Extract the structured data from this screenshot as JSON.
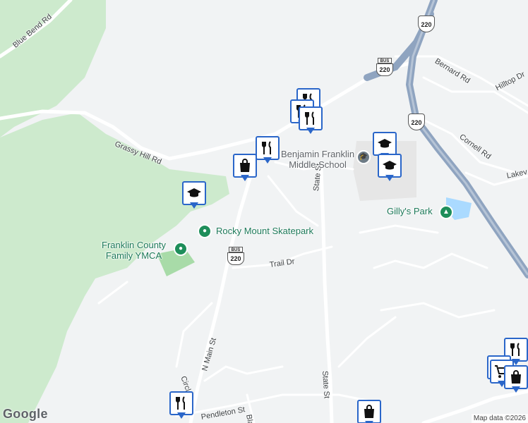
{
  "map": {
    "attribution": "Map data ©2026",
    "logo": "Google"
  },
  "roads": [
    {
      "name": "Blue Bend Rd"
    },
    {
      "name": "Grassy Hill Rd"
    },
    {
      "name": "Bernard Rd"
    },
    {
      "name": "Hilltop Dr"
    },
    {
      "name": "Cornell Rd"
    },
    {
      "name": "Lakev"
    },
    {
      "name": "State St"
    },
    {
      "name": "State St"
    },
    {
      "name": "Trail Dr"
    },
    {
      "name": "N Main St"
    },
    {
      "name": "Circle"
    },
    {
      "name": "Pendleton St"
    },
    {
      "name": "Bland"
    }
  ],
  "places": [
    {
      "name": "Benjamin Franklin\nMiddle School",
      "icon": "school-icon"
    },
    {
      "name": "Gilly's Park",
      "icon": "park-icon"
    },
    {
      "name": "Rocky Mount Skatepark",
      "icon": "park-icon"
    },
    {
      "name": "Franklin County\nFamily YMCA",
      "icon": "park-icon"
    }
  ],
  "route_shields": [
    {
      "top": "",
      "number": "220"
    },
    {
      "top": "BUS",
      "number": "220"
    },
    {
      "top": "",
      "number": "220"
    },
    {
      "top": "BUS",
      "number": "220"
    }
  ],
  "markers": [
    {
      "type": "restaurant",
      "icon": "fork-knife-icon"
    },
    {
      "type": "restaurant",
      "icon": "fork-knife-icon"
    },
    {
      "type": "restaurant",
      "icon": "fork-knife-icon"
    },
    {
      "type": "restaurant",
      "icon": "fork-knife-icon"
    },
    {
      "type": "shopping",
      "icon": "shopping-bag-icon"
    },
    {
      "type": "school",
      "icon": "graduation-cap-icon"
    },
    {
      "type": "school",
      "icon": "graduation-cap-icon"
    },
    {
      "type": "school",
      "icon": "graduation-cap-icon"
    },
    {
      "type": "restaurant",
      "icon": "fork-knife-icon"
    },
    {
      "type": "restaurant",
      "icon": "fork-knife-icon"
    },
    {
      "type": "grocery",
      "icon": "shopping-cart-icon"
    },
    {
      "type": "shopping",
      "icon": "shopping-bag-icon"
    },
    {
      "type": "restaurant",
      "icon": "fork-knife-icon"
    },
    {
      "type": "shopping",
      "icon": "shopping-bag-icon"
    }
  ],
  "colors": {
    "background": "#f1f3f4",
    "green_area": "#cdeacd",
    "highway": "#8fa4c0",
    "road": "#ffffff",
    "marker_border": "#2a66c9",
    "poi_green": "#1e8e5a"
  }
}
